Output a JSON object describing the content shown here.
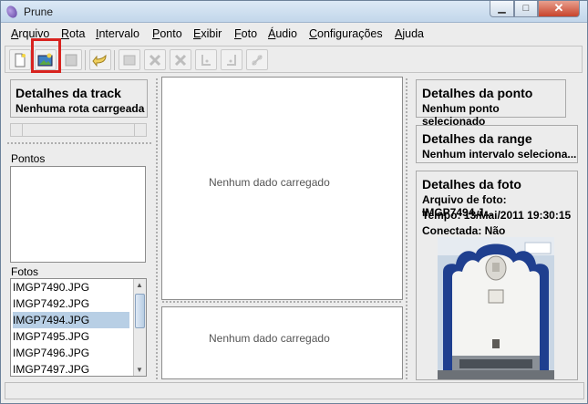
{
  "window": {
    "title": "Prune",
    "min_glyph": "▁",
    "max_glyph": "□",
    "close_glyph": "✕"
  },
  "menu": [
    {
      "label": "Arquivo",
      "id": "arquivo"
    },
    {
      "label": "Rota",
      "id": "rota"
    },
    {
      "label": "Intervalo",
      "id": "intervalo"
    },
    {
      "label": "Ponto",
      "id": "ponto"
    },
    {
      "label": "Exibir",
      "id": "exibir"
    },
    {
      "label": "Foto",
      "id": "foto"
    },
    {
      "label": "Áudio",
      "id": "audio"
    },
    {
      "label": "Configurações",
      "id": "configuracoes"
    },
    {
      "label": "Ajuda",
      "id": "ajuda"
    }
  ],
  "toolbar": {
    "buttons": [
      {
        "icon": "new-file-icon",
        "enabled": true
      },
      {
        "icon": "add-photo-icon",
        "enabled": true
      },
      {
        "icon": "save-icon",
        "enabled": false
      },
      {
        "icon": "undo-icon",
        "enabled": true
      },
      {
        "icon": "edit-icon",
        "enabled": false
      },
      {
        "icon": "delete-point-icon",
        "enabled": false
      },
      {
        "icon": "delete-range-icon",
        "enabled": false
      },
      {
        "icon": "select-start-icon",
        "enabled": false
      },
      {
        "icon": "select-end-icon",
        "enabled": false
      },
      {
        "icon": "connect-icon",
        "enabled": false
      }
    ]
  },
  "left": {
    "track_title": "Detalhes da track",
    "track_status": "Nenhuma rota carrgeada",
    "points_label": "Pontos",
    "photos_label": "Fotos",
    "photos": [
      "IMGP7490.JPG",
      "IMGP7492.JPG",
      "IMGP7494.JPG",
      "IMGP7495.JPG",
      "IMGP7496.JPG",
      "IMGP7497.JPG"
    ],
    "selected_photo": "IMGP7494.JPG"
  },
  "center": {
    "map_message": "Nenhum dado carregado",
    "profile_message": "Nenhum dado carregado"
  },
  "right": {
    "point_title": "Detalhes da ponto",
    "point_status": "Nenhum ponto selecionado",
    "range_title": "Detalhes da range",
    "range_status": "Nenhum intervalo seleciona...",
    "photo_title": "Detalhes da foto",
    "photo_file": "Arquivo de foto: IMGP7494.J...",
    "photo_time": "Tempo: 13/Mai/2011 19:30:15",
    "photo_connected": "Conectada: Não"
  },
  "colors": {
    "highlight": "#d8231f",
    "selection": "#b8cfe5"
  }
}
